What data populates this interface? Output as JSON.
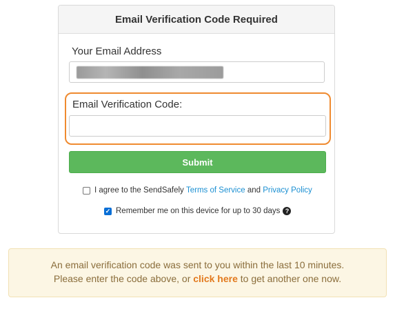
{
  "card": {
    "title": "Email Verification Code Required",
    "email_label": "Your Email Address",
    "email_value": "",
    "code_label": "Email Verification Code:",
    "code_value": "",
    "submit_label": "Submit",
    "agree": {
      "checked": false,
      "prefix": "I agree to the SendSafely",
      "terms_link": "Terms of Service",
      "and": "and",
      "privacy_link": "Privacy Policy"
    },
    "remember": {
      "checked": true,
      "label": "Remember me on this device for up to 30 days"
    }
  },
  "notice": {
    "line1": "An email verification code was sent to you within the last 10 minutes.",
    "line2_prefix": "Please enter the code above, or",
    "link": "click here",
    "line2_suffix": "to get another one now."
  },
  "colors": {
    "highlight": "#ef8a2f",
    "submit": "#5cb85c",
    "link": "#1a8fd2",
    "notice_bg": "#fcf6e4",
    "notice_link": "#e2791d"
  },
  "icons": {
    "check": "checkmark-icon",
    "help": "question-circle-icon"
  }
}
